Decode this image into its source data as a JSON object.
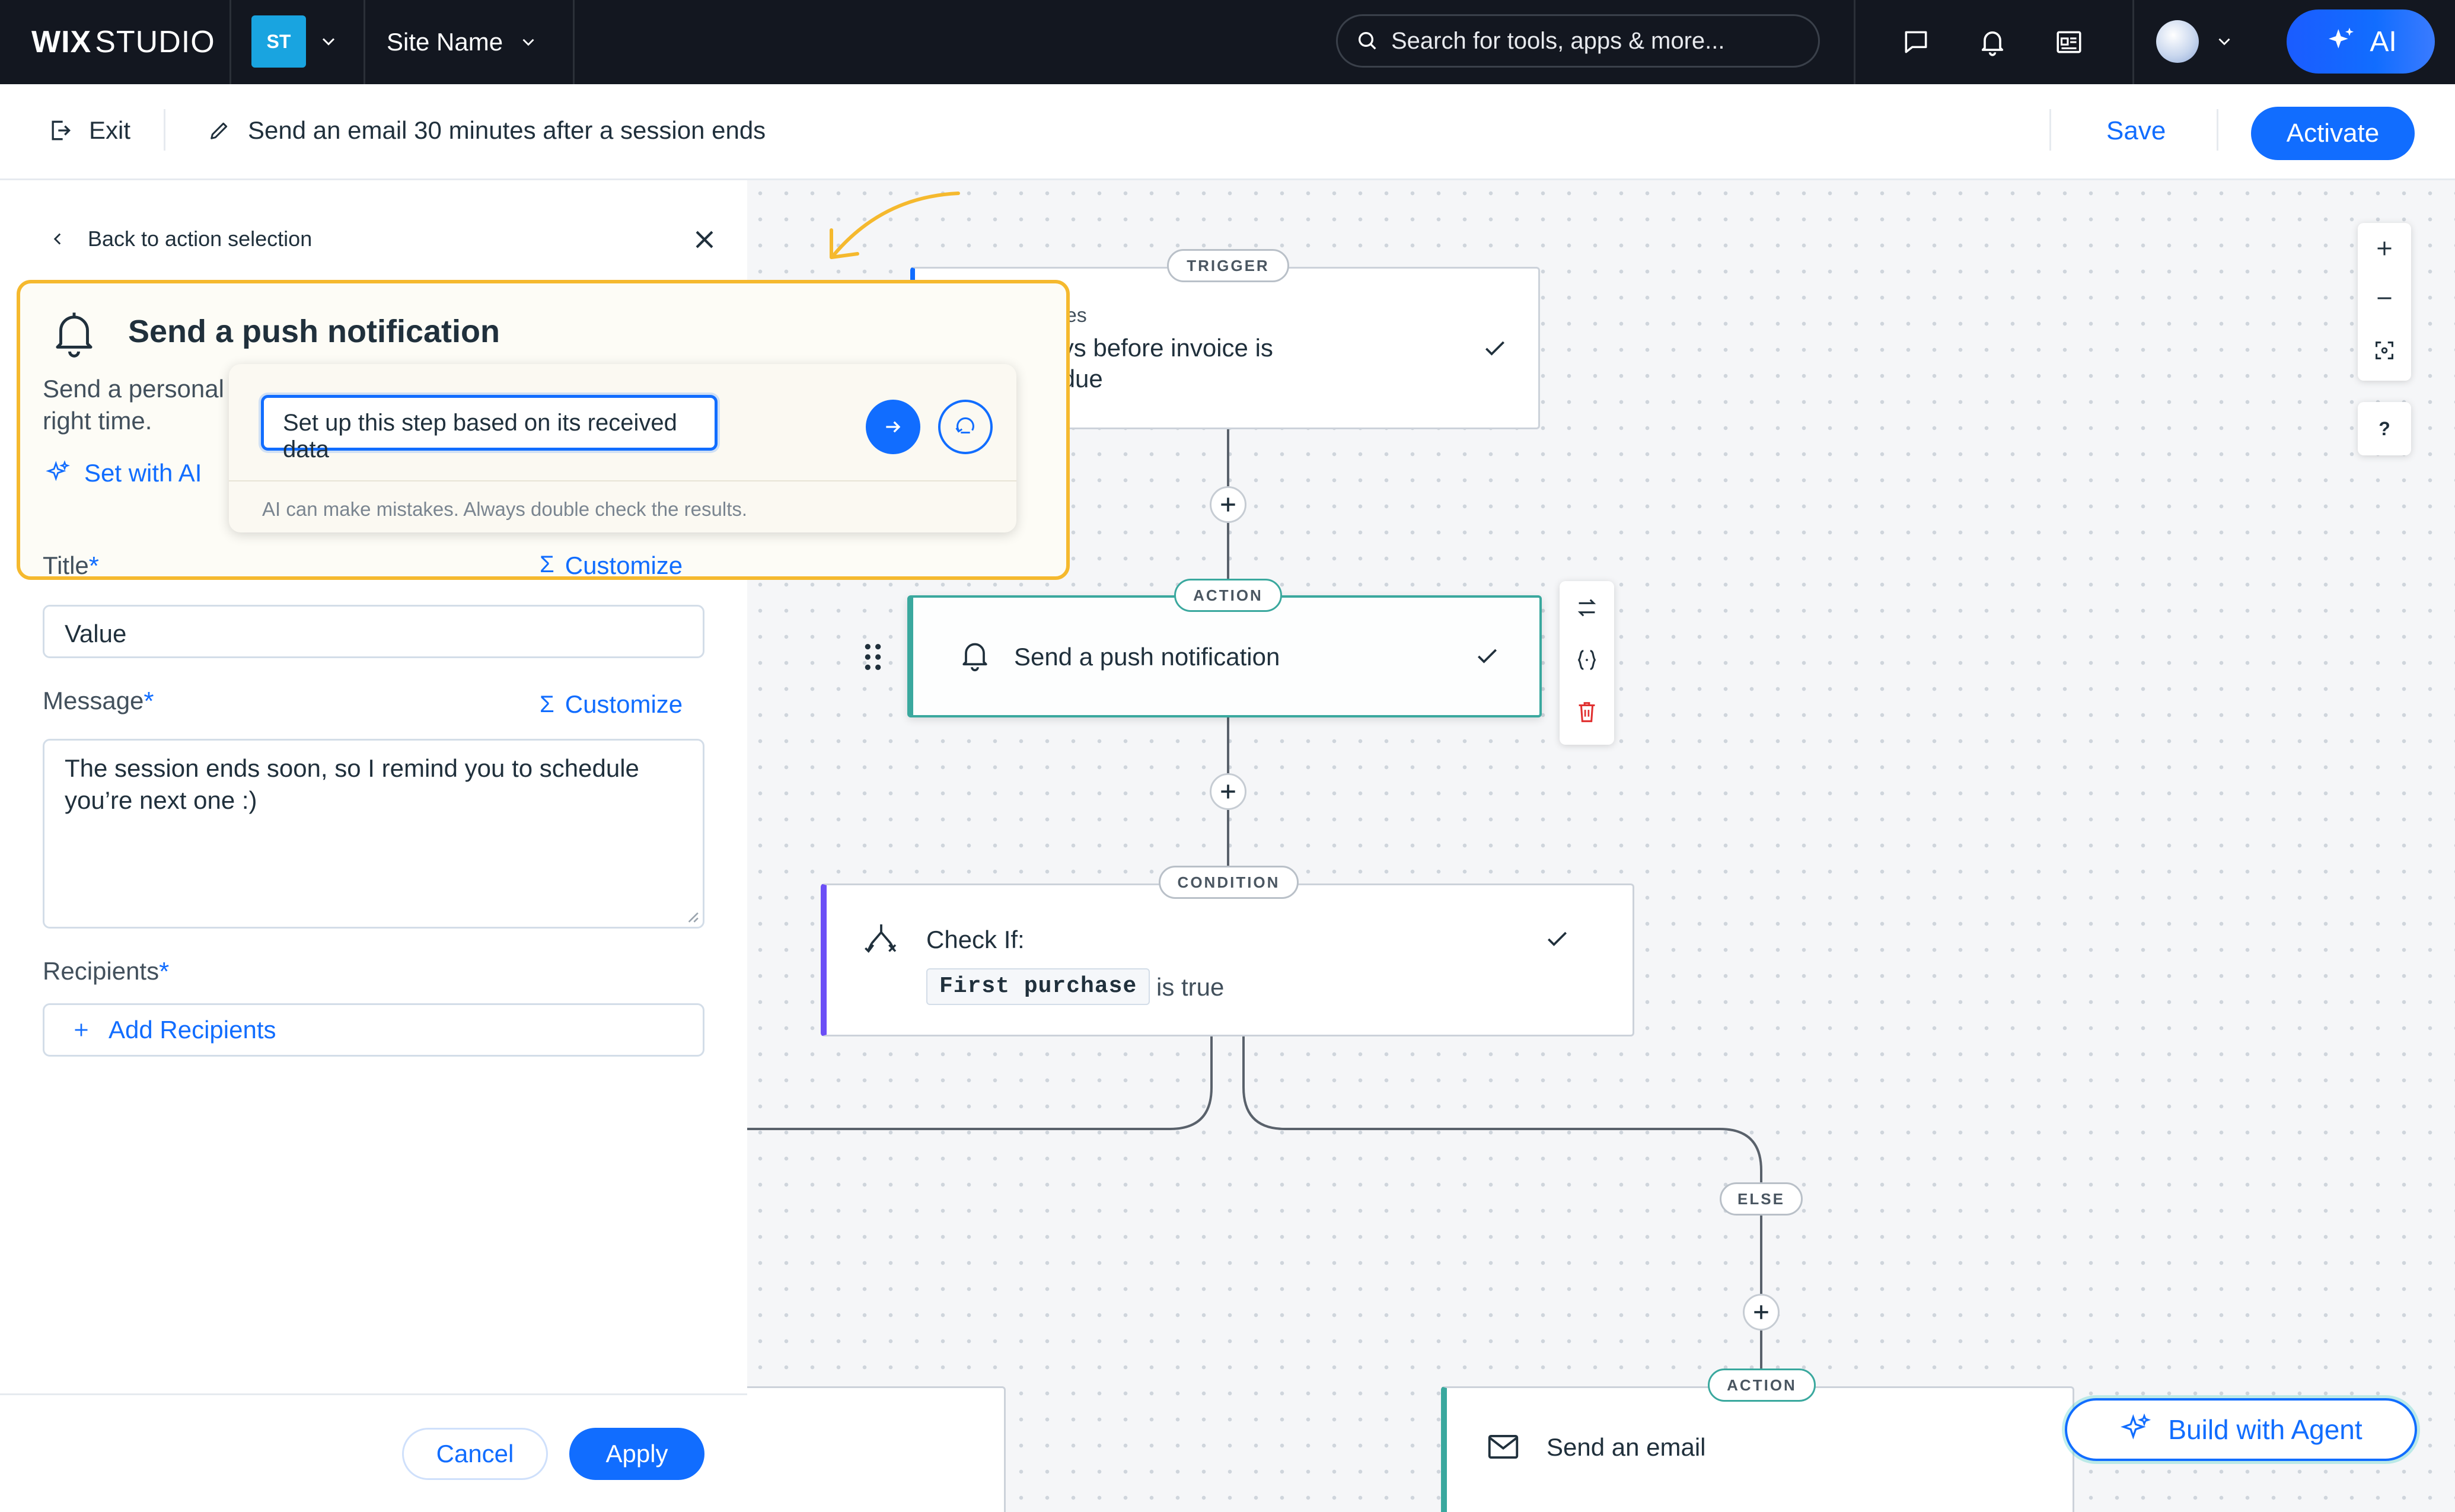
{
  "topbar": {
    "logo_bold": "WIX",
    "logo_rest": "STUDIO",
    "workspace_badge": "ST",
    "site_name": "Site Name",
    "search_placeholder": "Search for tools, apps & more...",
    "ai_label": "AI"
  },
  "subbar": {
    "exit_label": "Exit",
    "automation_name": "Send an email 30 minutes after a session ends",
    "save_label": "Save",
    "activate_label": "Activate"
  },
  "panel": {
    "back_label": "Back to action selection",
    "action_title": "Send a push notification",
    "description_line1": "Send a personal",
    "description_line2": "right time.",
    "set_with_ai_label": "Set with AI",
    "title_label": "Title",
    "title_value": "Value",
    "customize_label": "Customize",
    "message_label": "Message",
    "message_value": "The session ends soon, so I remind you to schedule you’re next one :)",
    "recipients_label": "Recipients",
    "add_recipients_label": "Add Recipients",
    "cancel_label": "Cancel",
    "apply_label": "Apply",
    "required_mark": "*"
  },
  "ai_popup": {
    "prompt_value": "Set up this step based on its received data",
    "disclaimer": "AI can make mistakes. Always double check the results."
  },
  "flow": {
    "trigger": {
      "pill": "TRIGGER",
      "app": "Invoices",
      "title_line1": "7 days before invoice is",
      "title_line2": "overdue"
    },
    "action1": {
      "pill": "ACTION",
      "title": "Send a push notification"
    },
    "condition": {
      "pill": "CONDITION",
      "title": "Check If:",
      "variable": "First purchase",
      "suffix": "is true"
    },
    "else_pill": "ELSE",
    "action2": {
      "pill": "ACTION",
      "title": "Send an email"
    },
    "build_agent_label": "Build with Agent",
    "zoom_help": "?"
  },
  "colors": {
    "accent": "#116dff",
    "topbar_bg": "#131720",
    "highlight": "#f5b92e",
    "trigger_accent": "#116dff",
    "action_accent": "#3aa89e",
    "condition_accent": "#6b4ff6",
    "delete_red": "#e02f2f"
  }
}
